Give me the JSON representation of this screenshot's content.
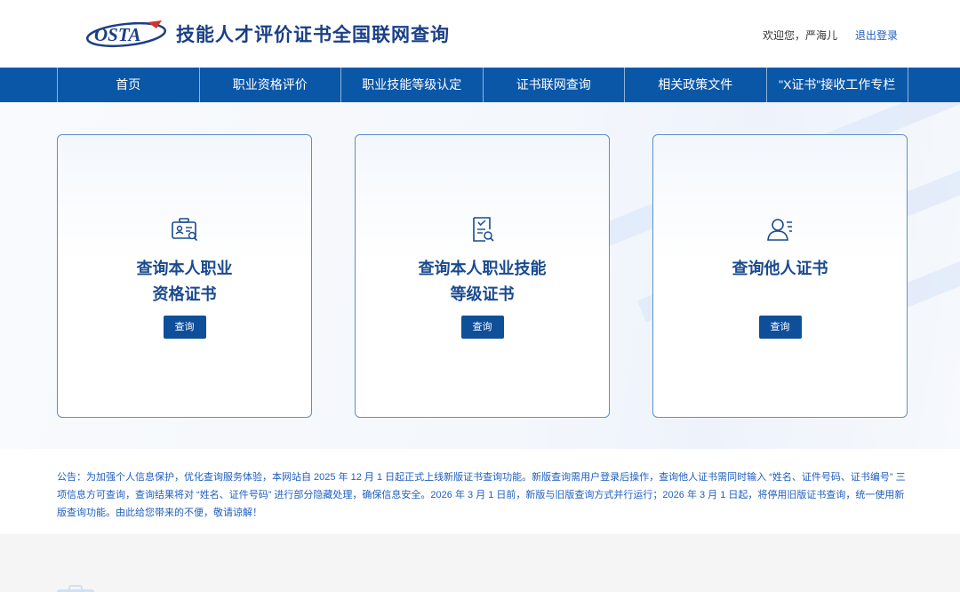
{
  "header": {
    "logo_text": "OSTA",
    "site_title": "技能人才评价证书全国联网查询",
    "welcome": "欢迎您，严海儿",
    "logout": "退出登录"
  },
  "nav": {
    "items": [
      {
        "label": "首页"
      },
      {
        "label": "职业资格评价"
      },
      {
        "label": "职业技能等级认定"
      },
      {
        "label": "证书联网查询"
      },
      {
        "label": "相关政策文件"
      },
      {
        "label": "\"X证书\"接收工作专栏"
      }
    ]
  },
  "cards": [
    {
      "title_line1": "查询本人职业",
      "title_line2": "资格证书",
      "button": "查询",
      "icon": "id-card-search-icon"
    },
    {
      "title_line1": "查询本人职业技能",
      "title_line2": "等级证书",
      "button": "查询",
      "icon": "certificate-search-icon"
    },
    {
      "title_line1": "查询他人证书",
      "title_line2": "",
      "button": "查询",
      "icon": "user-list-icon"
    }
  ],
  "notice": "公告：为加强个人信息保护，优化查询服务体验，本网站自 2025 年 12 月 1 日起正式上线新版证书查询功能。新版查询需用户登录后操作，查询他人证书需同时输入 “姓名、证件号码、证书编号” 三项信息方可查询，查询结果将对 “姓名、证件号码” 进行部分隐藏处理，确保信息安全。2026 年 3 月 1 日前，新版与旧版查询方式并行运行；2026 年 3 月 1 日起，将停用旧版证书查询，统一使用新版查询功能。由此给您带来的不便，敬请谅解！",
  "colors": {
    "nav_bg": "#0a57a8",
    "title_blue": "#1a3f86",
    "card_border": "#5e8fc7",
    "button_bg": "#0f4f9a",
    "notice_text": "#1f5fbf"
  }
}
